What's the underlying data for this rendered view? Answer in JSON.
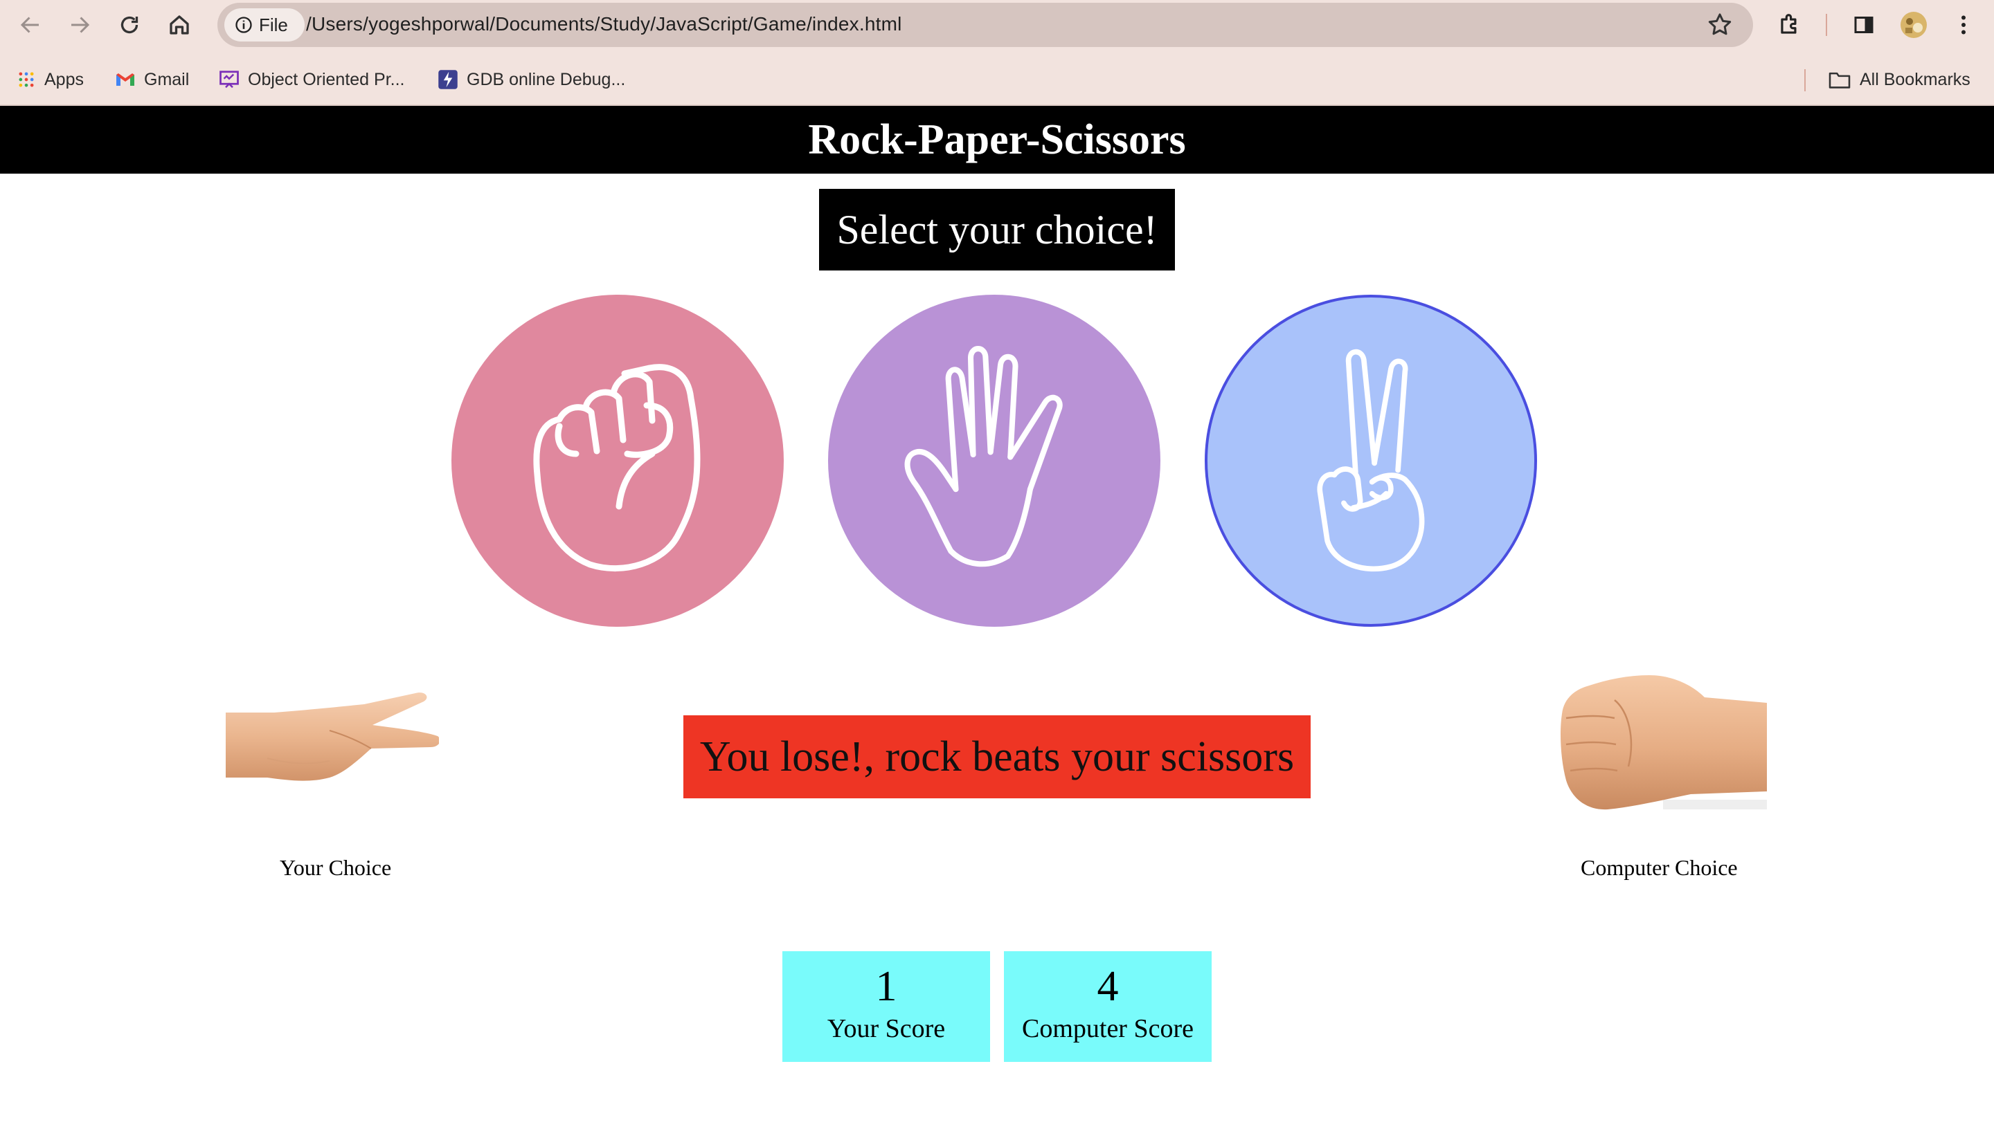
{
  "browser": {
    "url_chip_label": "File",
    "url": "/Users/yogeshporwal/Documents/Study/JavaScript/Game/index.html",
    "bookmarks": [
      {
        "label": "Apps",
        "icon": "apps-grid-icon"
      },
      {
        "label": "Gmail",
        "icon": "gmail-icon"
      },
      {
        "label": "Object Oriented Pr...",
        "icon": "presentation-icon"
      },
      {
        "label": "GDB online Debug...",
        "icon": "gdb-icon"
      }
    ],
    "all_bookmarks_label": "All Bookmarks"
  },
  "game": {
    "title": "Rock-Paper-Scissors",
    "prompt": "Select your choice!",
    "choices": [
      {
        "id": "rock",
        "color": "#e0889e"
      },
      {
        "id": "paper",
        "color": "#b992d6"
      },
      {
        "id": "scissors",
        "color": "#a9c2fa",
        "selected": true
      }
    ],
    "result_message": "You lose!, rock beats your scissors",
    "result_color": "#ee3524",
    "your_choice_label": "Your Choice",
    "computer_choice_label": "Computer Choice",
    "user_score": "1",
    "user_score_label": "Your Score",
    "computer_score": "4",
    "computer_score_label": "Computer Score",
    "score_box_color": "#79fbfb"
  }
}
